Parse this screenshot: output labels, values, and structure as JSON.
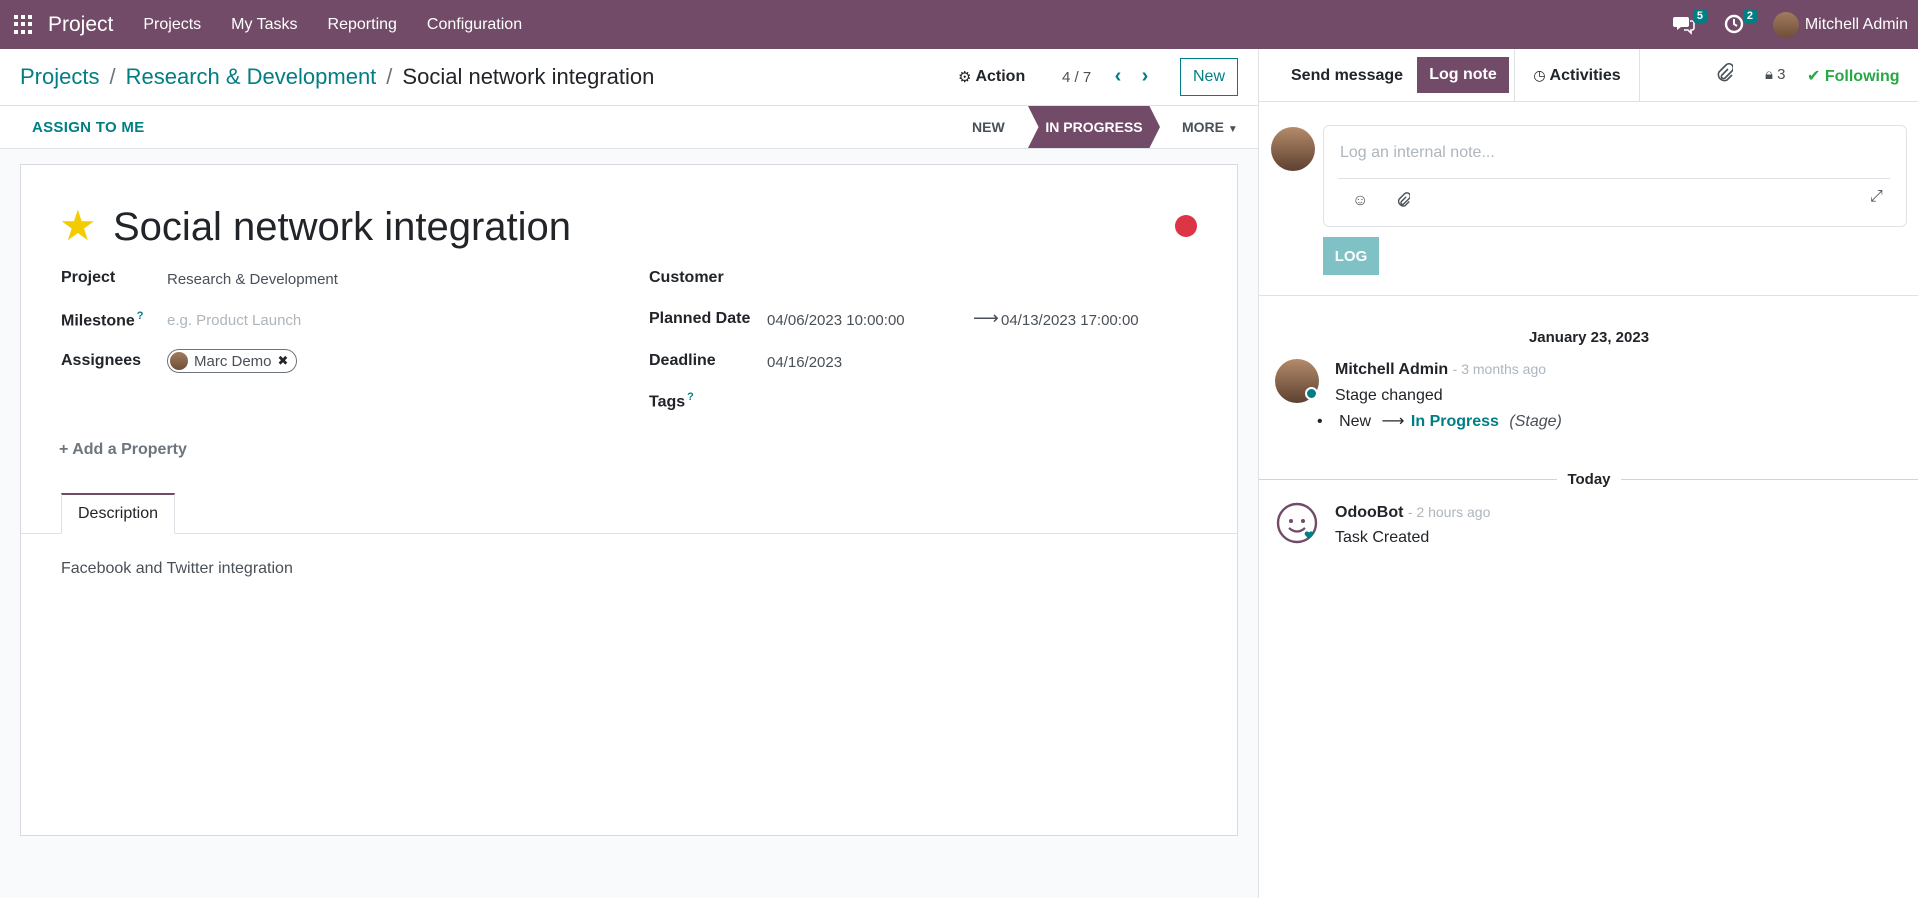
{
  "topbar": {
    "brand": "Project",
    "nav": [
      "Projects",
      "My Tasks",
      "Reporting",
      "Configuration"
    ],
    "messages_count": "5",
    "activities_count": "2",
    "user_name": "Mitchell Admin"
  },
  "control": {
    "breadcrumb": [
      "Projects",
      "Research & Development",
      "Social network integration"
    ],
    "action_label": "Action",
    "pager": "4 / 7",
    "new_label": "New"
  },
  "statusbar": {
    "assign_label": "ASSIGN TO ME",
    "stages": [
      "NEW",
      "IN PROGRESS",
      "MORE"
    ]
  },
  "form": {
    "title": "Social network integration",
    "fields": {
      "project_label": "Project",
      "project_value": "Research & Development",
      "milestone_label": "Milestone",
      "milestone_placeholder": "e.g. Product Launch",
      "assignees_label": "Assignees",
      "assignee_value": "Marc Demo",
      "customer_label": "Customer",
      "planned_label": "Planned Date",
      "planned_start": "04/06/2023 10:00:00",
      "planned_end": "04/13/2023 17:00:00",
      "deadline_label": "Deadline",
      "deadline_value": "04/16/2023",
      "tags_label": "Tags"
    },
    "add_property": "Add a Property",
    "tab_label": "Description",
    "description": "Facebook and Twitter integration"
  },
  "chatter": {
    "send_message": "Send message",
    "log_note": "Log note",
    "activities": "Activities",
    "followers_count": "3",
    "following": "Following",
    "composer_placeholder": "Log an internal note...",
    "log_button": "LOG",
    "date1": "January 23, 2023",
    "msg1_author": "Mitchell Admin",
    "msg1_time": "- 3 months ago",
    "msg1_body": "Stage changed",
    "msg1_old": "New",
    "msg1_new": "In Progress",
    "msg1_field": "(Stage)",
    "date2": "Today",
    "msg2_author": "OdooBot",
    "msg2_time": "- 2 hours ago",
    "msg2_body": "Task Created"
  },
  "colors": {
    "brand": "#714b67",
    "accent": "#017e84",
    "priority": "#dc3545",
    "star": "#f3cc00"
  }
}
